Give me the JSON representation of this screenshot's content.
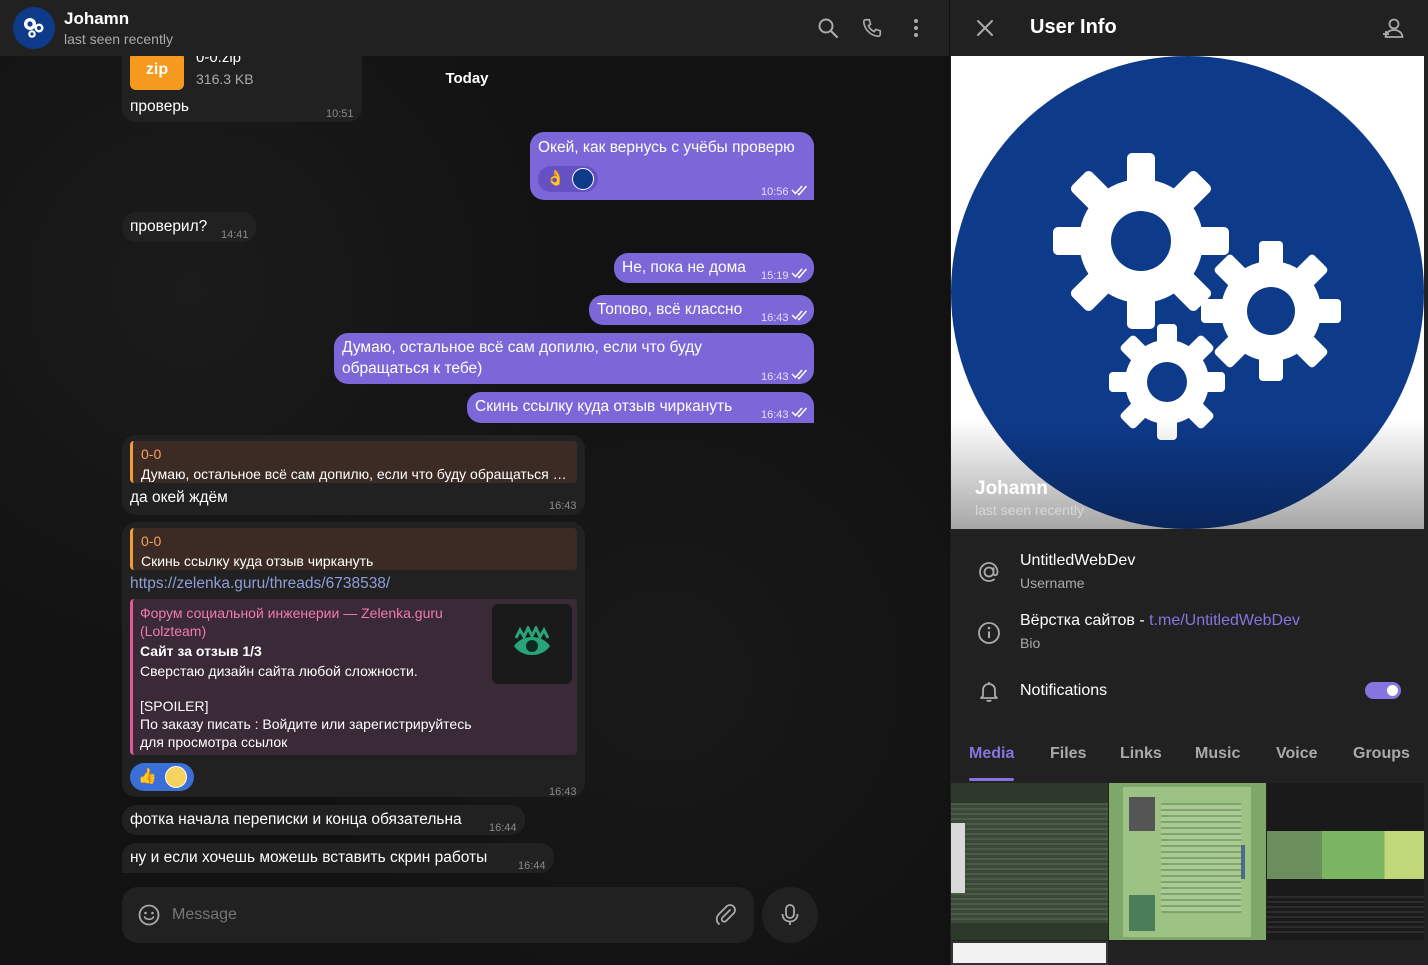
{
  "chat_header": {
    "name": "Johamn",
    "status": "last seen recently",
    "avatar_icon": "gears-icon"
  },
  "date_separator": "Today",
  "messages": [
    {
      "id": "m1",
      "direction": "in",
      "file_ext": "zip",
      "file_name": "0-0.zip",
      "file_size": "316.3 KB",
      "text": "проверь",
      "time": "10:51"
    },
    {
      "id": "m2",
      "direction": "out",
      "text": "Окей, как вернусь с учёбы проверю",
      "reactions": [
        "👌"
      ],
      "time": "10:56"
    },
    {
      "id": "m3",
      "direction": "in",
      "text": "проверил?",
      "time": "14:41"
    },
    {
      "id": "m4",
      "direction": "out",
      "text": "Не, пока не дома",
      "time": "15:19"
    },
    {
      "id": "m5",
      "direction": "out",
      "text": "Топово, всё классно",
      "time": "16:43"
    },
    {
      "id": "m6",
      "direction": "out",
      "text_line1": "Думаю, остальное всё сам допилю, если что буду",
      "text_line2": "обращаться к тебе)",
      "time": "16:43"
    },
    {
      "id": "m7",
      "direction": "out",
      "text": "Скинь ссылку куда отзыв чиркануть",
      "time": "16:43"
    },
    {
      "id": "m8",
      "direction": "in",
      "reply_name": "0-0",
      "reply_text": "Думаю, остальное всё сам допилю, если что буду обращаться к...",
      "text": "да окей ждём",
      "time": "16:43"
    },
    {
      "id": "m9",
      "direction": "in",
      "reply_name": "0-0",
      "reply_text": "Скинь ссылку куда отзыв чиркануть",
      "link": "https://zelenka.guru/threads/6738538/",
      "preview_site_line1": "Форум социальной инженерии — Zelenka.guru",
      "preview_site_line2": "(Lolzteam)",
      "preview_title": "Сайт за отзыв 1/3",
      "preview_desc": "Сверстаю дизайн сайта любой сложности.",
      "preview_spoiler": "[SPOILER]",
      "preview_more_line1": "По заказу писать : Войдите или зарегистрируйтесь",
      "preview_more_line2": "для просмотра ссылок",
      "reactions": [
        "👍"
      ],
      "time": "16:43"
    },
    {
      "id": "m10",
      "direction": "in",
      "text": "фотка начала переписки и конца обязательна",
      "time": "16:44"
    },
    {
      "id": "m11",
      "direction": "in",
      "text": "ну и если хочешь можешь вставить скрин работы",
      "time": "16:44"
    }
  ],
  "composer": {
    "placeholder": "Message"
  },
  "info": {
    "title": "User Info",
    "name": "Johamn",
    "status": "last seen recently",
    "username": "UntitledWebDev",
    "username_label": "Username",
    "bio_text": "Вёрстка сайтов - ",
    "bio_link": "t.me/UntitledWebDev",
    "bio_label": "Bio",
    "notifications_label": "Notifications",
    "notifications_on": true,
    "tabs": [
      "Media",
      "Files",
      "Links",
      "Music",
      "Voice",
      "Groups"
    ],
    "active_tab": "Media"
  },
  "colors": {
    "accent": "#8774e1",
    "outgoing_bubble": "#7c67d8",
    "incoming_bubble": "#212121",
    "avatar_blue": "#0e3a8a",
    "reply_orange": "#f7a35c",
    "preview_pink": "#e0579a"
  }
}
